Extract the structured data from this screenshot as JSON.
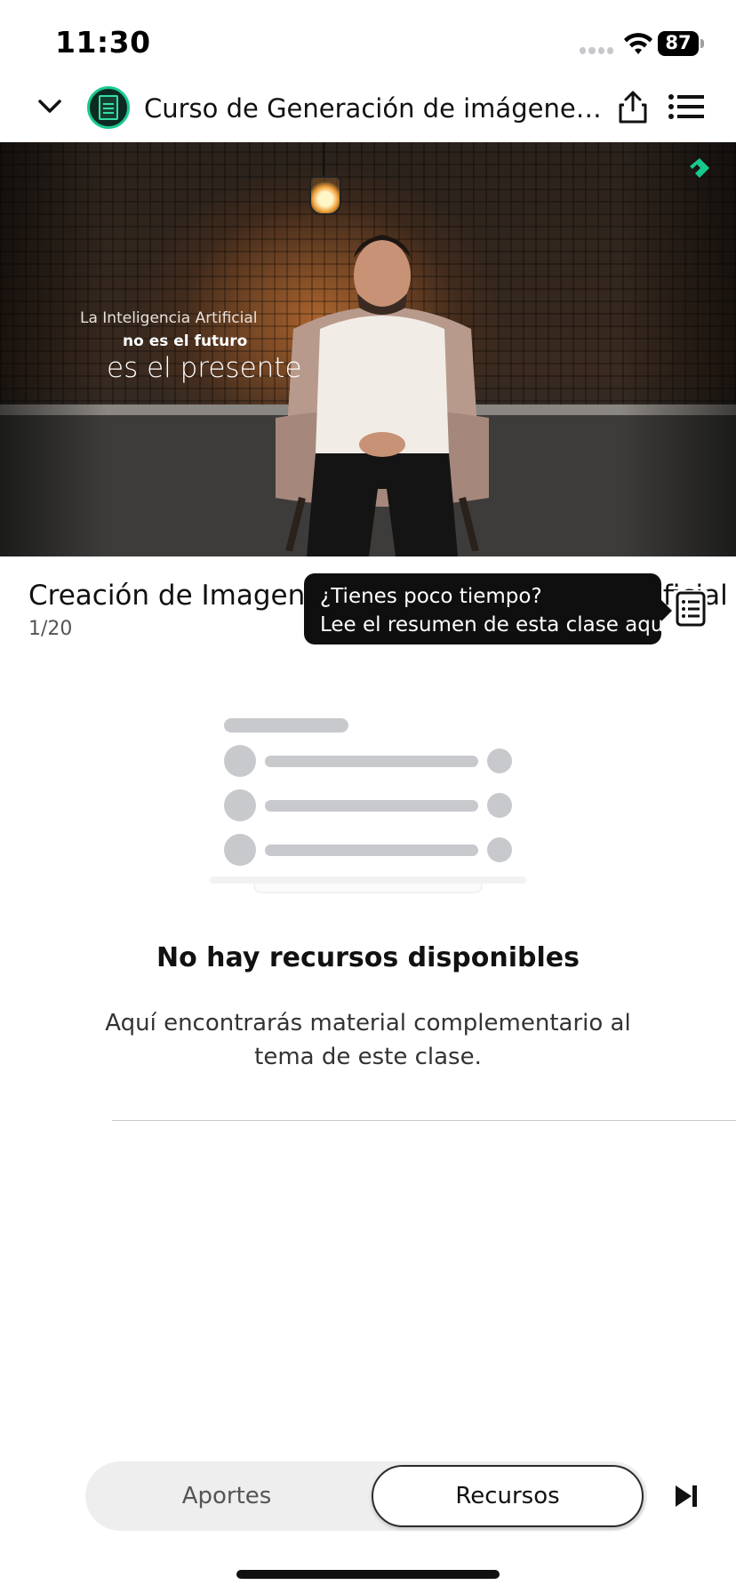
{
  "status_bar": {
    "time": "11:30",
    "battery": "87"
  },
  "header": {
    "course_title": "Curso de Generación de imágenes con..."
  },
  "video": {
    "overlay_line1": "La Inteligencia Artificial",
    "overlay_line2": "no es el futuro",
    "overlay_line3": "es el presente"
  },
  "class_info": {
    "title": "Creación de Imagene",
    "title_behind_tooltip": "a Artificial",
    "counter": "1/20"
  },
  "tooltip": {
    "line1": "¿Tienes poco tiempo?",
    "line2": "Lee el resumen de esta clase aquí."
  },
  "empty_state": {
    "title": "No hay recursos disponibles",
    "description": "Aquí encontrarás material complementario al tema de este clase."
  },
  "tabs": [
    {
      "label": "Aportes",
      "active": false
    },
    {
      "label": "Recursos",
      "active": true
    }
  ],
  "icons": {
    "back": "chevron-down-icon",
    "course": "course-badge-icon",
    "share": "share-icon",
    "list": "list-icon",
    "summary": "summary-icon",
    "next": "skip-next-icon",
    "brand": "platzi-logo"
  },
  "colors": {
    "accent": "#18c98f",
    "tooltip_bg": "#0f0f0f",
    "tab_bg": "#eeeeef"
  }
}
